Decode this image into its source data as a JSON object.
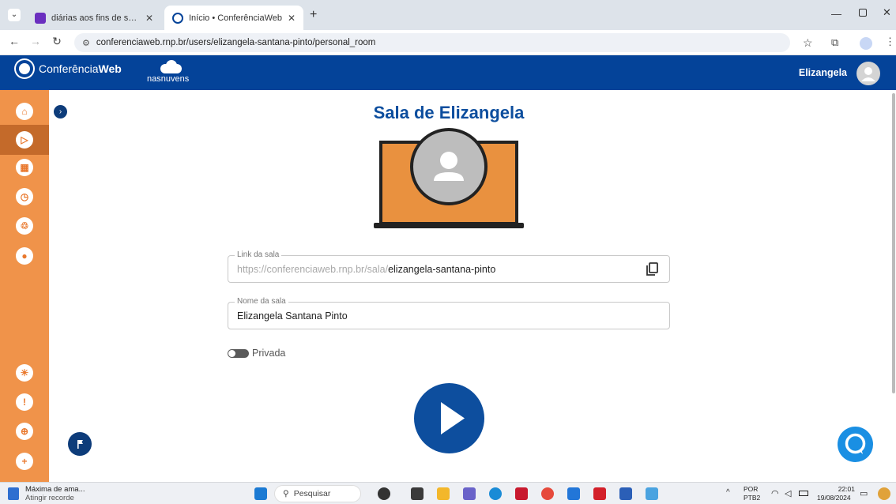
{
  "browser": {
    "tabs": [
      {
        "title": "diárias aos fins de semana scdp",
        "favicon_color": "#6b2fbf",
        "active": false
      },
      {
        "title": "Início • ConferênciaWeb",
        "favicon_color": "#044399",
        "active": true
      }
    ],
    "new_tab": "+",
    "url": "conferenciaweb.rnp.br/users/elizangela-santana-pinto/personal_room"
  },
  "header": {
    "logo_text_regular": "Conferência",
    "logo_text_bold": "Web",
    "cloud_logo_text": "nasnuvens",
    "user_name": "Elizangela"
  },
  "sidebar": {
    "items": [
      {
        "icon": "home-icon"
      },
      {
        "icon": "play-icon",
        "active": true
      },
      {
        "icon": "calendar-icon"
      },
      {
        "icon": "history-icon"
      },
      {
        "icon": "recycle-icon"
      },
      {
        "icon": "bell-icon"
      },
      {
        "icon": "lightbulb-icon"
      },
      {
        "icon": "feedback-icon"
      },
      {
        "icon": "globe-icon"
      },
      {
        "icon": "add-icon"
      }
    ]
  },
  "main": {
    "title": "Sala de Elizangela",
    "link_field": {
      "label": "Link da sala",
      "prefix": "https://conferenciaweb.rnp.br/sala/",
      "slug": "elizangela-santana-pinto"
    },
    "name_field": {
      "label": "Nome da sala",
      "value": "Elizangela Santana Pinto"
    },
    "private_toggle": {
      "label": "Privada",
      "on": false
    }
  },
  "taskbar": {
    "weather_line1": "Máxima de ama...",
    "weather_line2": "Atingir recorde",
    "search_placeholder": "Pesquisar",
    "lang_line1": "POR",
    "lang_line2": "PTB2",
    "time": "22:01",
    "date": "19/08/2024"
  },
  "colors": {
    "brand_blue": "#044399",
    "sidebar_orange": "#f0934a",
    "title_blue": "#0d4e9e"
  }
}
